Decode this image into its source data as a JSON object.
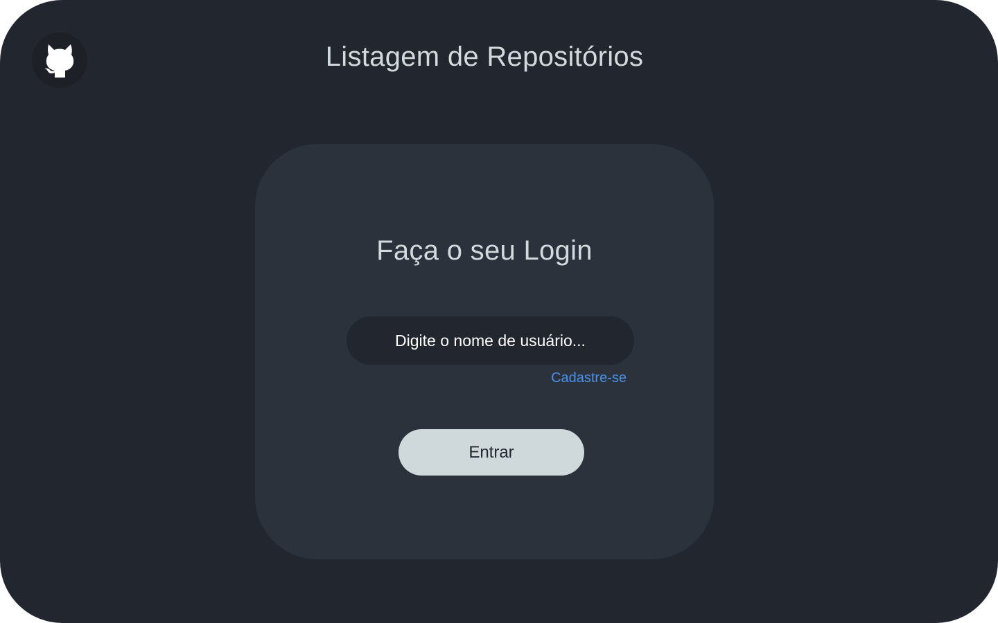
{
  "header": {
    "logo_icon": "github-octocat-icon",
    "title": "Listagem de Repositórios"
  },
  "login": {
    "title": "Faça o seu Login",
    "username_placeholder": "Digite o nome de usuário...",
    "username_value": "",
    "signup_label": "Cadastre-se",
    "submit_label": "Entrar"
  },
  "colors": {
    "background": "#22262e",
    "card": "#2c323b",
    "text": "#d3dadd",
    "link": "#4a90e8",
    "button": "#cfd8da"
  }
}
